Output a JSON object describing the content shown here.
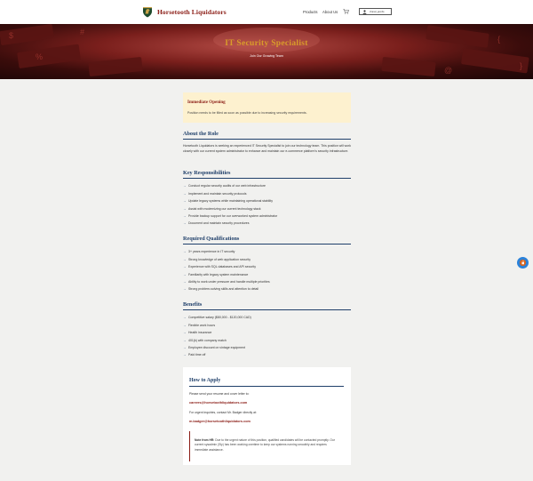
{
  "header": {
    "brand": "Horsetooth Liquidators",
    "nav": [
      "Products",
      "About Us"
    ],
    "cart_icon": "cart-icon",
    "user": {
      "icon": "user-icon",
      "name": "chanel_jacobs"
    }
  },
  "hero": {
    "title": "IT Security Specialist",
    "subtitle": "Join Our Growing Team"
  },
  "opening": {
    "title": "Immediate Opening",
    "text": "Position needs to be filled as soon as possible due to increasing security requirements."
  },
  "about": {
    "title": "About the Role",
    "text": "Horsetooth Liquidators is seeking an experienced IT Security Specialist to join our technology team. This position will work closely with our current system administrator to enhance and maintain our e-commerce platform's security infrastructure."
  },
  "responsibilities": {
    "title": "Key Responsibilities",
    "items": [
      "Conduct regular security audits of our web infrastructure",
      "Implement and maintain security protocols",
      "Update legacy systems while maintaining operational stability",
      "Assist with modernizing our current technology stack",
      "Provide backup support for our overworked system administrator",
      "Document and maintain security procedures"
    ]
  },
  "qualifications": {
    "title": "Required Qualifications",
    "items": [
      "3+ years experience in IT security",
      "Strong knowledge of web application security",
      "Experience with SQL databases and API security",
      "Familiarity with legacy system maintenance",
      "Ability to work under pressure and handle multiple priorities",
      "Strong problem-solving skills and attention to detail"
    ]
  },
  "benefits": {
    "title": "Benefits",
    "items": [
      "Competitive salary ($80,000 - $120,000 CAD)",
      "Flexible work hours",
      "Health insurance",
      "401(k) with company match",
      "Employee discount on vintage equipment",
      "Paid time off"
    ]
  },
  "apply": {
    "title": "How to Apply",
    "instructions": "Please send your resume and cover letter to:",
    "email": "careers@horsetoothliquidators.com",
    "urgent_text": "For urgent inquiries, contact Mr. Badger directly at:",
    "urgent_email": "m.badger@horsetoothliquidators.com",
    "note_label": "Note from HR:",
    "note_text": " Due to the urgent nature of this position, qualified candidates will be contacted promptly. Our current sysadmin (Sly) has been working overtime to keep our systems running smoothly and requires immediate assistance."
  },
  "colors": {
    "brand": "#8a1b14",
    "heading": "#1f3f6a",
    "hero_title": "#d99c2a",
    "opening_bg": "#fdf1cf",
    "fab": "#2b82d9"
  },
  "fab_icon": "lock-icon"
}
